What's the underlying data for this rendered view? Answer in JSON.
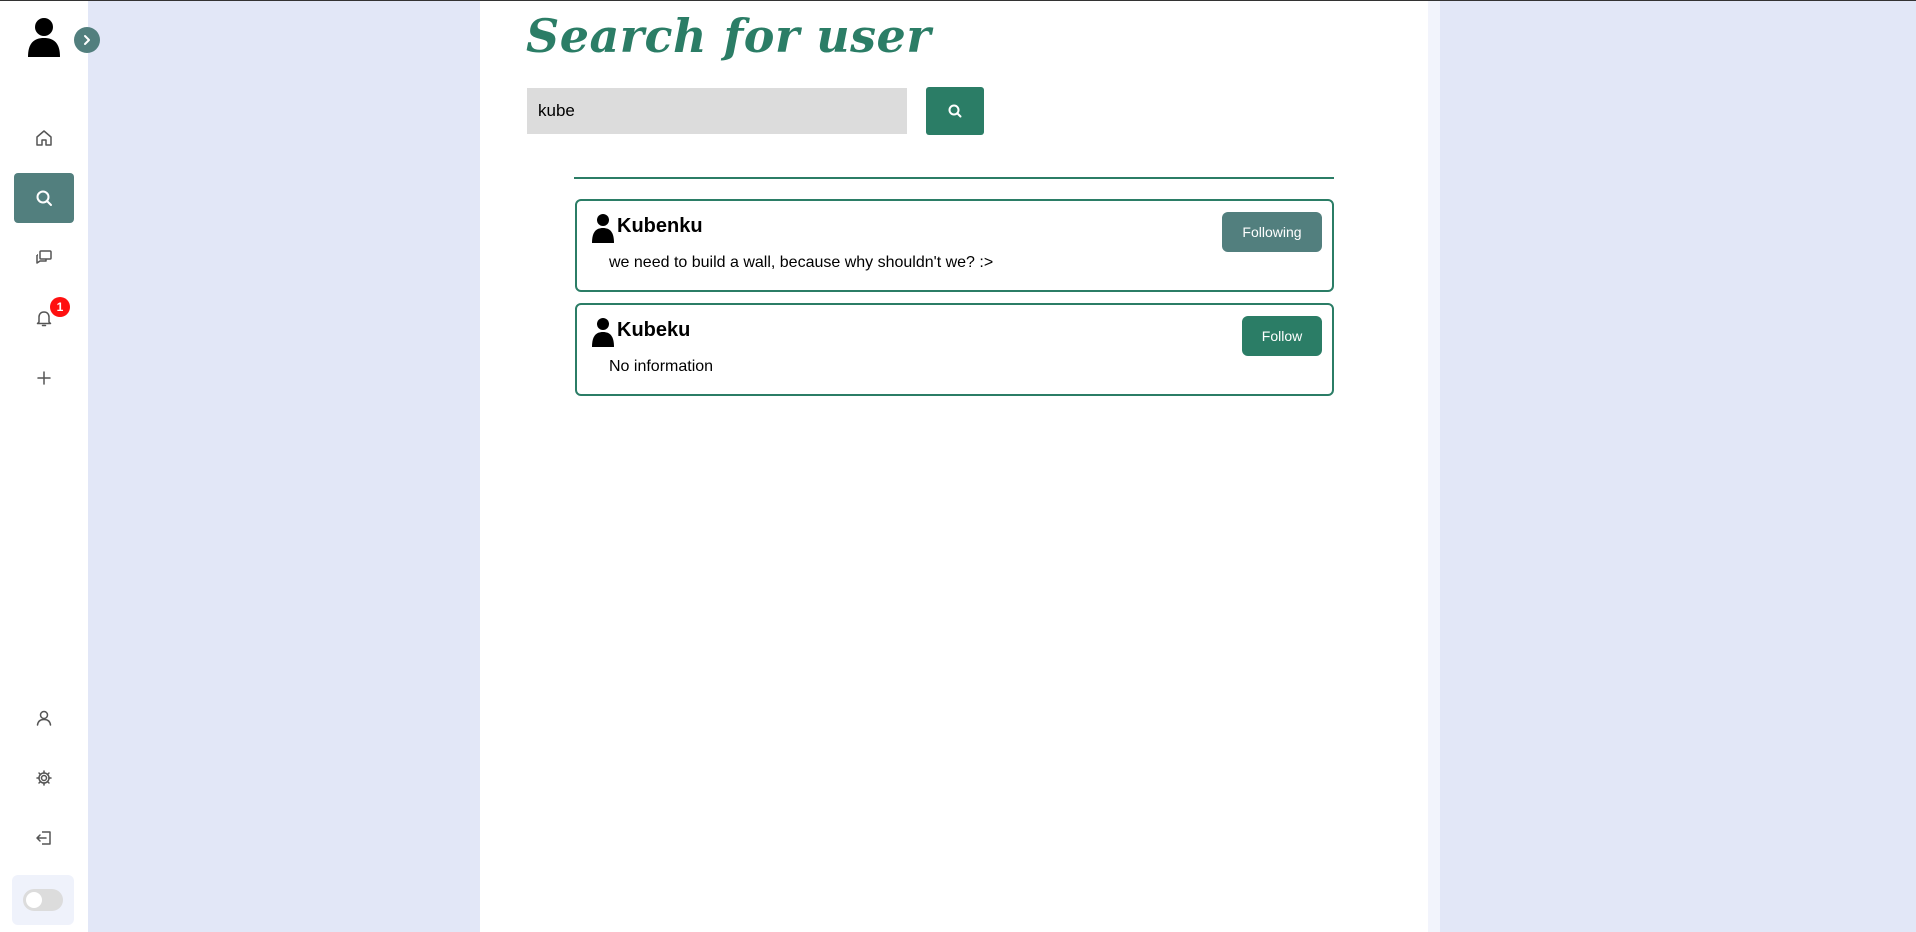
{
  "sidebar": {
    "items": [
      {
        "name": "home",
        "icon": "home-icon"
      },
      {
        "name": "search",
        "icon": "search-icon",
        "active": true
      },
      {
        "name": "messages",
        "icon": "chat-icon"
      },
      {
        "name": "notifications",
        "icon": "bell-icon",
        "badge": "1"
      },
      {
        "name": "create",
        "icon": "plus-icon"
      },
      {
        "name": "profile",
        "icon": "user-icon"
      },
      {
        "name": "settings",
        "icon": "gear-icon"
      },
      {
        "name": "logout",
        "icon": "logout-icon"
      }
    ],
    "theme_toggle": {
      "enabled": false
    }
  },
  "main": {
    "title": "Search for user",
    "search": {
      "value": "kube"
    },
    "results": [
      {
        "username": "Kubenku",
        "bio": "we need to build a wall, because why shouldn't we? :>",
        "button_label": "Following"
      },
      {
        "username": "Kubeku",
        "bio": "No information",
        "button_label": "Follow"
      }
    ]
  },
  "colors": {
    "accent": "#2b7d66",
    "accent_muted": "#527f7e",
    "background": "#e2e7f7",
    "badge": "#ff1010"
  }
}
